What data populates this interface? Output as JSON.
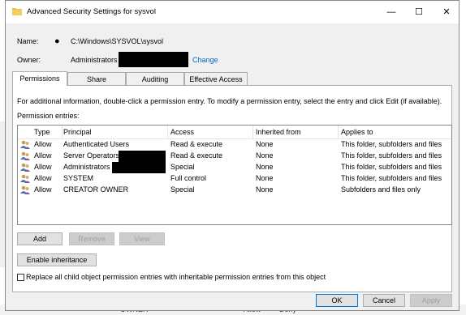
{
  "window": {
    "title": "Advanced Security Settings for sysvol",
    "minimize": "—",
    "maximize": "☐",
    "close": "✕"
  },
  "name_row": {
    "label": "Name:",
    "value": "C:\\Windows\\SYSVOL\\sysvol"
  },
  "owner_row": {
    "label": "Owner:",
    "value": "Administrators",
    "change_link": "Change"
  },
  "tabs": [
    {
      "label": "Permissions",
      "active": true
    },
    {
      "label": "Share",
      "active": false
    },
    {
      "label": "Auditing",
      "active": false
    },
    {
      "label": "Effective Access",
      "active": false
    }
  ],
  "info_text": "For additional information, double-click a permission entry. To modify a permission entry, select the entry and click Edit (if available).",
  "permission_entries_label": "Permission entries:",
  "columns": [
    "Type",
    "Principal",
    "Access",
    "Inherited from",
    "Applies to"
  ],
  "entries": [
    {
      "type": "Allow",
      "principal": "Authenticated Users",
      "access": "Read & execute",
      "inherited": "None",
      "applies": "This folder, subfolders and files"
    },
    {
      "type": "Allow",
      "principal": "Server Operators",
      "access": "Read & execute",
      "inherited": "None",
      "applies": "This folder, subfolders and files"
    },
    {
      "type": "Allow",
      "principal": "Administrators",
      "access": "Special",
      "inherited": "None",
      "applies": "This folder, subfolders and files"
    },
    {
      "type": "Allow",
      "principal": "SYSTEM",
      "access": "Full control",
      "inherited": "None",
      "applies": "This folder, subfolders and files"
    },
    {
      "type": "Allow",
      "principal": "CREATOR OWNER",
      "access": "Special",
      "inherited": "None",
      "applies": "Subfolders and files only"
    }
  ],
  "buttons": {
    "add": "Add",
    "remove": "Remove",
    "view": "View",
    "enable_inheritance": "Enable inheritance",
    "ok": "OK",
    "cancel": "Cancel",
    "apply": "Apply"
  },
  "replace_checkbox_label": "Replace all child object permission entries with inheritable permission entries from this object",
  "background_row": {
    "col1": "OWNER",
    "col2": "Allow",
    "col3": "Deny"
  },
  "colors": {
    "accent": "#0078d7",
    "link": "#0066cc"
  }
}
